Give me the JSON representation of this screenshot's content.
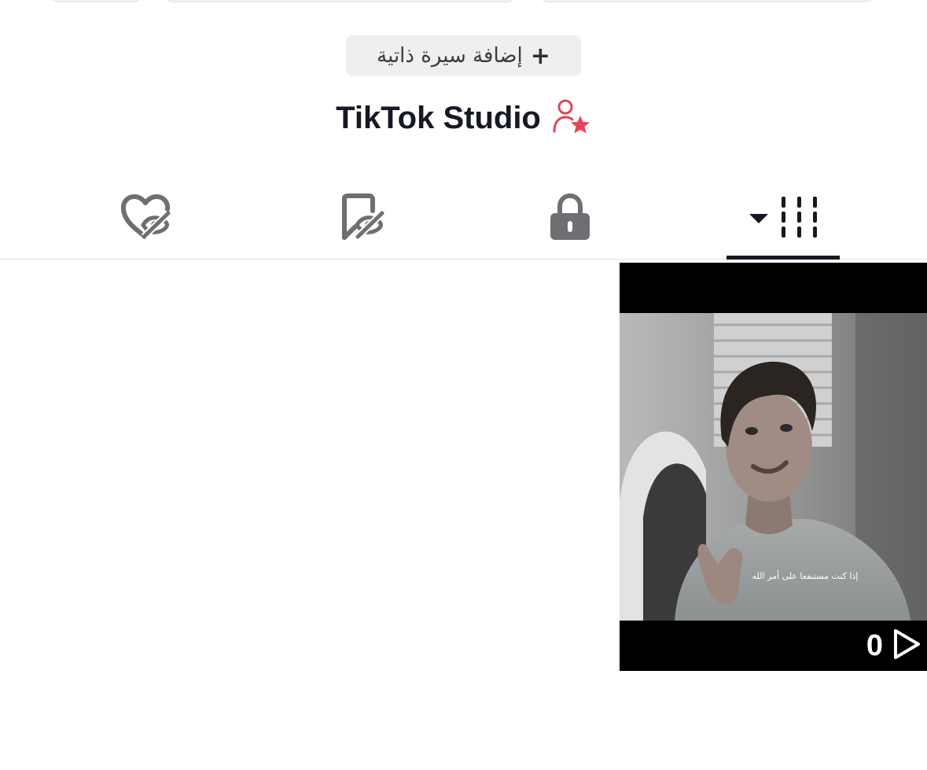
{
  "profile": {
    "bio_button": {
      "plus": "+",
      "label": "إضافة سيرة ذاتية"
    },
    "studio_link": {
      "label": "TikTok Studio",
      "icon": "user-star-icon",
      "icon_color": "#e2445c"
    }
  },
  "tabs": [
    {
      "name": "videos",
      "icon": "grid-dropdown-icon",
      "active": true
    },
    {
      "name": "private",
      "icon": "lock-icon"
    },
    {
      "name": "favorites",
      "icon": "bookmark-eye-off-icon"
    },
    {
      "name": "liked",
      "icon": "heart-eye-off-icon"
    }
  ],
  "videos": [
    {
      "views": "0",
      "caption": "إذا كنت مستنفعا على أمر الله",
      "play_icon": "play-outline-icon"
    }
  ],
  "colors": {
    "text_primary": "#161823",
    "icon_gray": "#6f6f73",
    "accent": "#e2445c"
  }
}
